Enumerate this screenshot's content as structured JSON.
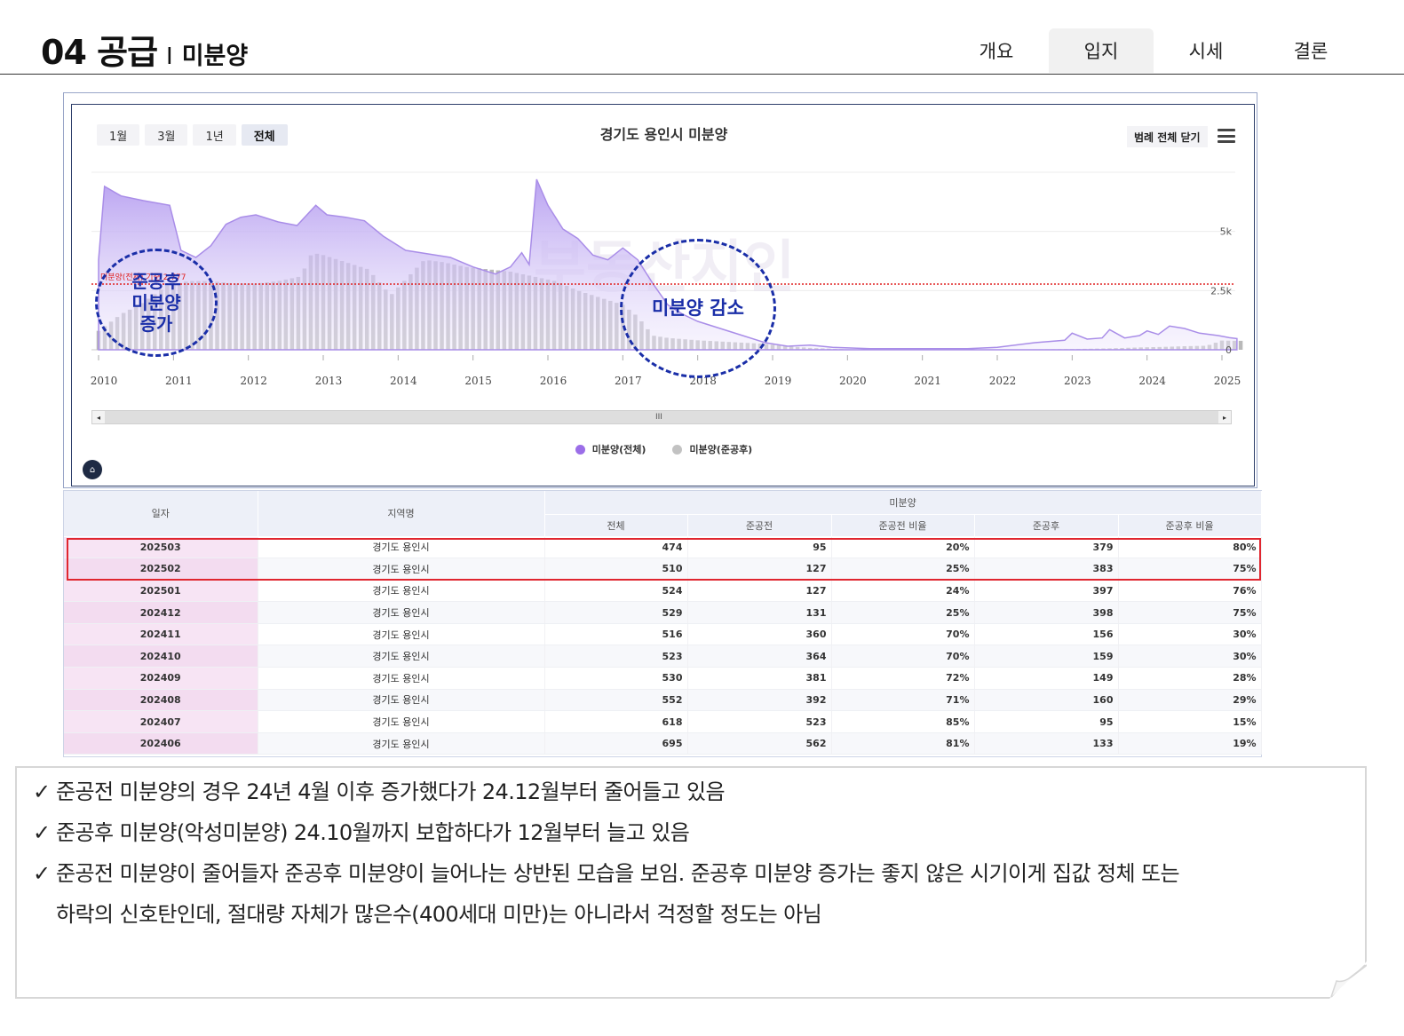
{
  "header": {
    "title_main": "04 공급",
    "title_sep": "I",
    "title_sub": "미분양",
    "tabs": [
      {
        "label": "개요",
        "active": false
      },
      {
        "label": "입지",
        "active": true
      },
      {
        "label": "시세",
        "active": false
      },
      {
        "label": "결론",
        "active": false
      }
    ]
  },
  "chart_panel": {
    "range_buttons": [
      "1월",
      "3월",
      "1년",
      "전체"
    ],
    "active_range": "전체",
    "legend_close_label": "범례 전체 닫기",
    "annotation_left": "준공후\n미분양\n증가",
    "annotation_right": "미분양 감소",
    "ref_line_label": "미분양(전체) 기준 2,777",
    "watermark": "부동산지인"
  },
  "chart_data": {
    "type": "area",
    "title": "경기도 용인시 미분양",
    "x_ticks": [
      "2010",
      "2011",
      "2012",
      "2013",
      "2014",
      "2015",
      "2016",
      "2017",
      "2018",
      "2019",
      "2020",
      "2021",
      "2022",
      "2023",
      "2024",
      "2025"
    ],
    "y_ticks": [
      "0",
      "2.5k",
      "5k"
    ],
    "ylim": [
      0,
      7500
    ],
    "reference_line": 2777,
    "series": [
      {
        "name": "미분양(전체)",
        "type": "area",
        "color": "#b59df0",
        "points": [
          [
            2010.0,
            3800
          ],
          [
            2010.08,
            6900
          ],
          [
            2010.3,
            6500
          ],
          [
            2010.6,
            6300
          ],
          [
            2010.95,
            6100
          ],
          [
            2011.1,
            4200
          ],
          [
            2011.3,
            3900
          ],
          [
            2011.5,
            4400
          ],
          [
            2011.7,
            5300
          ],
          [
            2011.9,
            5600
          ],
          [
            2012.1,
            5700
          ],
          [
            2012.4,
            5400
          ],
          [
            2012.65,
            5250
          ],
          [
            2012.9,
            6100
          ],
          [
            2013.05,
            5700
          ],
          [
            2013.3,
            5600
          ],
          [
            2013.55,
            5450
          ],
          [
            2013.8,
            4800
          ],
          [
            2014.1,
            4200
          ],
          [
            2014.4,
            4050
          ],
          [
            2014.7,
            3900
          ],
          [
            2015.0,
            3500
          ],
          [
            2015.3,
            3200
          ],
          [
            2015.5,
            3500
          ],
          [
            2015.65,
            4100
          ],
          [
            2015.75,
            3600
          ],
          [
            2015.85,
            7200
          ],
          [
            2016.0,
            6100
          ],
          [
            2016.2,
            5100
          ],
          [
            2016.4,
            4700
          ],
          [
            2016.6,
            4000
          ],
          [
            2016.8,
            3800
          ],
          [
            2017.0,
            4300
          ],
          [
            2017.2,
            3800
          ],
          [
            2017.4,
            2800
          ],
          [
            2017.6,
            1900
          ],
          [
            2017.8,
            1500
          ],
          [
            2018.0,
            1200
          ],
          [
            2018.3,
            900
          ],
          [
            2018.6,
            600
          ],
          [
            2018.9,
            300
          ],
          [
            2019.2,
            150
          ],
          [
            2019.5,
            200
          ],
          [
            2019.8,
            100
          ],
          [
            2020.3,
            50
          ],
          [
            2021.0,
            50
          ],
          [
            2021.6,
            50
          ],
          [
            2022.0,
            100
          ],
          [
            2022.5,
            300
          ],
          [
            2022.9,
            400
          ],
          [
            2023.0,
            700
          ],
          [
            2023.2,
            450
          ],
          [
            2023.4,
            500
          ],
          [
            2023.5,
            850
          ],
          [
            2023.7,
            500
          ],
          [
            2023.9,
            600
          ],
          [
            2024.0,
            800
          ],
          [
            2024.15,
            650
          ],
          [
            2024.3,
            1000
          ],
          [
            2024.5,
            900
          ],
          [
            2024.7,
            700
          ],
          [
            2024.95,
            600
          ],
          [
            2025.1,
            510
          ],
          [
            2025.2,
            474
          ]
        ]
      },
      {
        "name": "미분양(준공후)",
        "type": "bar",
        "color": "#b9b9b9",
        "points": [
          [
            2010.0,
            800
          ],
          [
            2010.3,
            1500
          ],
          [
            2010.6,
            2000
          ],
          [
            2010.9,
            2700
          ],
          [
            2011.2,
            2900
          ],
          [
            2011.5,
            2900
          ],
          [
            2011.8,
            2800
          ],
          [
            2012.1,
            2800
          ],
          [
            2012.4,
            2900
          ],
          [
            2012.7,
            3100
          ],
          [
            2012.85,
            4100
          ],
          [
            2013.0,
            4000
          ],
          [
            2013.3,
            3700
          ],
          [
            2013.6,
            3400
          ],
          [
            2013.9,
            2300
          ],
          [
            2014.2,
            3300
          ],
          [
            2014.35,
            3800
          ],
          [
            2014.6,
            3700
          ],
          [
            2014.9,
            3500
          ],
          [
            2015.2,
            3400
          ],
          [
            2015.5,
            3300
          ],
          [
            2015.8,
            3100
          ],
          [
            2016.1,
            2900
          ],
          [
            2016.4,
            2500
          ],
          [
            2016.7,
            2200
          ],
          [
            2017.0,
            1900
          ],
          [
            2017.2,
            1400
          ],
          [
            2017.4,
            600
          ],
          [
            2017.6,
            500
          ],
          [
            2017.8,
            450
          ],
          [
            2018.0,
            400
          ],
          [
            2018.3,
            350
          ],
          [
            2018.6,
            300
          ],
          [
            2018.9,
            250
          ],
          [
            2019.2,
            150
          ],
          [
            2019.5,
            80
          ],
          [
            2020.0,
            20
          ],
          [
            2021.0,
            10
          ],
          [
            2022.0,
            10
          ],
          [
            2023.0,
            30
          ],
          [
            2023.5,
            60
          ],
          [
            2023.9,
            100
          ],
          [
            2024.2,
            120
          ],
          [
            2024.5,
            150
          ],
          [
            2024.8,
            170
          ],
          [
            2025.0,
            390
          ],
          [
            2025.2,
            379
          ]
        ]
      }
    ]
  },
  "table": {
    "group_header": "미분양",
    "headers": [
      "일자",
      "지역명",
      "전체",
      "준공전",
      "준공전 비율",
      "준공후",
      "준공후 비율"
    ],
    "rows": [
      [
        "202503",
        "경기도 용인시",
        "474",
        "95",
        "20%",
        "379",
        "80%"
      ],
      [
        "202502",
        "경기도 용인시",
        "510",
        "127",
        "25%",
        "383",
        "75%"
      ],
      [
        "202501",
        "경기도 용인시",
        "524",
        "127",
        "24%",
        "397",
        "76%"
      ],
      [
        "202412",
        "경기도 용인시",
        "529",
        "131",
        "25%",
        "398",
        "75%"
      ],
      [
        "202411",
        "경기도 용인시",
        "516",
        "360",
        "70%",
        "156",
        "30%"
      ],
      [
        "202410",
        "경기도 용인시",
        "523",
        "364",
        "70%",
        "159",
        "30%"
      ],
      [
        "202409",
        "경기도 용인시",
        "530",
        "381",
        "72%",
        "149",
        "28%"
      ],
      [
        "202408",
        "경기도 용인시",
        "552",
        "392",
        "71%",
        "160",
        "29%"
      ],
      [
        "202407",
        "경기도 용인시",
        "618",
        "523",
        "85%",
        "95",
        "15%"
      ],
      [
        "202406",
        "경기도 용인시",
        "695",
        "562",
        "81%",
        "133",
        "19%"
      ]
    ]
  },
  "notes": [
    "준공전 미분양의 경우 24년 4월 이후 증가했다가 24.12월부터 줄어들고 있음",
    "준공후 미분양(악성미분양) 24.10월까지 보합하다가 12월부터 늘고 있음",
    "준공전 미분양이 줄어들자 준공후 미분양이 늘어나는 상반된 모습을 보임. 준공후 미분양 증가는 좋지 않은 시기이게 집값 정체 또는",
    "하락의 신호탄인데, 절대량 자체가 많은수(400세대 미만)는 아니라서 걱정할 정도는 아님"
  ],
  "check_glyph": "✓",
  "colors": {
    "accent_purple": "#b59df0",
    "bar_gray": "#b9b9b9",
    "reference_red": "#e02020",
    "annotation_blue": "#1a2ea8",
    "highlight_red": "#e0262f"
  }
}
